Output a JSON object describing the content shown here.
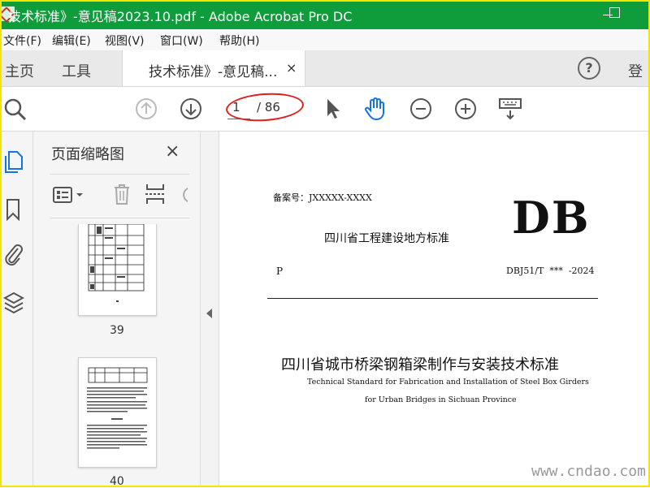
{
  "window": {
    "title": "技术标准》-意见稿2023.10.pdf - Adobe Acrobat Pro DC"
  },
  "menu": [
    "文件(F)",
    "编辑(E)",
    "视图(V)",
    "窗口(W)",
    "帮助(H)"
  ],
  "tabs": {
    "home": "主页",
    "tools": "工具",
    "document": "技术标准》-意见稿...",
    "close": "×",
    "help": "?",
    "signin": "登"
  },
  "toolbar": {
    "current_page": "1",
    "total_pages": "/ 86"
  },
  "thumbnails_panel": {
    "title": "页面缩略图",
    "close": "×",
    "pages": [
      "39",
      "40"
    ]
  },
  "document": {
    "record_no": "备案号：JXXXXX-XXXX",
    "db_mark": "DB",
    "local_standard": "四川省工程建设地方标准",
    "p_mark": "P",
    "code": "DBJ51/T  ***  -2024",
    "title_cn": "四川省城市桥梁钢箱梁制作与安装技术标准",
    "title_en_line1": "Technical Standard for Fabrication and Installation of Steel Box Girders",
    "title_en_line2": "for Urban Bridges in Sichuan Province"
  },
  "watermark": "www.cndao.com",
  "colors": {
    "titlebar": "#0f9d3b",
    "accent_blue": "#1473e6",
    "highlight_red": "#e02020",
    "frame_yellow": "#f2e600"
  }
}
